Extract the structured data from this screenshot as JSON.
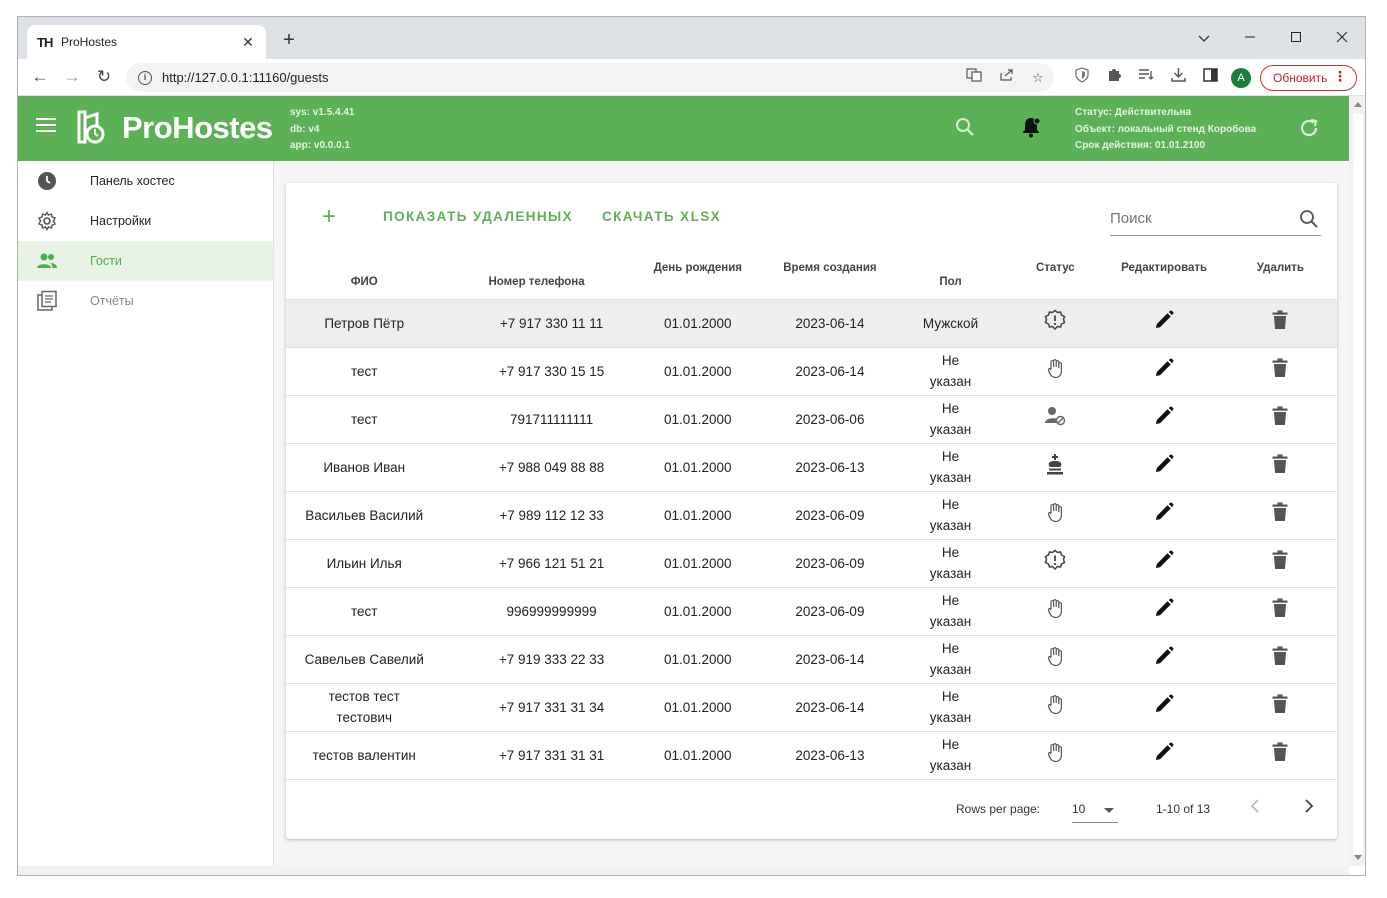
{
  "browser": {
    "tab_title": "ProHostes",
    "tab_favicon": "TH",
    "url": "http://127.0.0.1:11160/guests",
    "avatar_letter": "A",
    "update_label": "Обновить"
  },
  "app": {
    "brand": "ProHostes",
    "version": {
      "sys": "sys: v1.5.4.41",
      "db": "db: v4",
      "app": "app: v0.0.0.1"
    },
    "status": {
      "line1": "Статус: Действительна",
      "line2": "Объект: локальный стенд Коробова",
      "line3": "Срок действия: 01.01.2100"
    },
    "accent_color": "#5cb156"
  },
  "sidebar": {
    "items": [
      {
        "label": "Панель хостес",
        "icon": "clock-icon"
      },
      {
        "label": "Настройки",
        "icon": "gear-icon"
      },
      {
        "label": "Гости",
        "icon": "people-icon",
        "active": true
      },
      {
        "label": "Отчёты",
        "icon": "reports-icon"
      }
    ]
  },
  "toolbar": {
    "add_label": "+",
    "show_deleted_label": "ПОКАЗАТЬ УДАЛЕННЫХ",
    "download_label": "СКАЧАТЬ XLSX",
    "search_placeholder": "Поиск"
  },
  "table": {
    "headers": {
      "name": "ФИО",
      "phone": "Номер телефона",
      "birthday": "День рождения",
      "created": "Время создания",
      "gender": "Пол",
      "status": "Статус",
      "edit": "Редактировать",
      "delete": "Удалить"
    },
    "rows": [
      {
        "name": "Петров Пётр",
        "phone": "+7 917 330 11 11",
        "birthday": "01.01.2000",
        "created": "2023-06-14",
        "gender": "Мужской",
        "status_icon": "badge-alert-icon"
      },
      {
        "name": "тест",
        "phone": "+7 917 330 15 15",
        "birthday": "01.01.2000",
        "created": "2023-06-14",
        "gender": "Не указан",
        "status_icon": "hand-icon"
      },
      {
        "name": "тест",
        "phone": "791711111111",
        "birthday": "01.01.2000",
        "created": "2023-06-06",
        "gender": "Не указан",
        "status_icon": "user-blocked-icon"
      },
      {
        "name": "Иванов Иван",
        "phone": "+7 988 049 88 88",
        "birthday": "01.01.2000",
        "created": "2023-06-13",
        "gender": "Не указан",
        "status_icon": "chess-king-icon"
      },
      {
        "name": "Васильев Василий",
        "phone": "+7 989 112 12 33",
        "birthday": "01.01.2000",
        "created": "2023-06-09",
        "gender": "Не указан",
        "status_icon": "hand-icon"
      },
      {
        "name": "Ильин Илья",
        "phone": "+7 966 121 51 21",
        "birthday": "01.01.2000",
        "created": "2023-06-09",
        "gender": "Не указан",
        "status_icon": "badge-alert-icon"
      },
      {
        "name": "тест",
        "phone": "996999999999",
        "birthday": "01.01.2000",
        "created": "2023-06-09",
        "gender": "Не указан",
        "status_icon": "hand-icon"
      },
      {
        "name": "Савельев Савелий",
        "phone": "+7 919 333 22 33",
        "birthday": "01.01.2000",
        "created": "2023-06-14",
        "gender": "Не указан",
        "status_icon": "hand-icon"
      },
      {
        "name": "тестов тест тестович",
        "phone": "+7 917 331 31 34",
        "birthday": "01.01.2000",
        "created": "2023-06-14",
        "gender": "Не указан",
        "status_icon": "hand-icon"
      },
      {
        "name": "тестов валентин",
        "phone": "+7 917 331 31 31",
        "birthday": "01.01.2000",
        "created": "2023-06-13",
        "gender": "Не указан",
        "status_icon": "hand-icon"
      }
    ]
  },
  "pagination": {
    "rows_per_page_label": "Rows per page:",
    "rows_per_page_value": "10",
    "range_label": "1-10 of 13"
  }
}
